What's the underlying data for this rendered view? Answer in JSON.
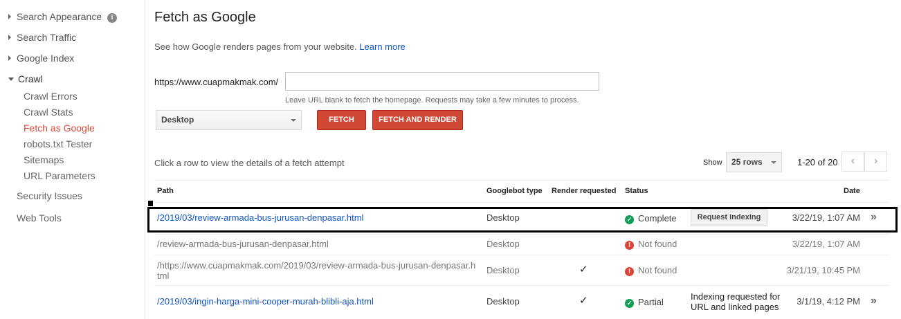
{
  "sidebar": {
    "items": [
      {
        "label": "Search Appearance"
      },
      {
        "label": "Search Traffic"
      },
      {
        "label": "Google Index"
      },
      {
        "label": "Crawl"
      }
    ],
    "crawl_sub": [
      {
        "label": "Crawl Errors"
      },
      {
        "label": "Crawl Stats"
      },
      {
        "label": "Fetch as Google"
      },
      {
        "label": "robots.txt Tester"
      },
      {
        "label": "Sitemaps"
      },
      {
        "label": "URL Parameters"
      }
    ],
    "bottom": [
      {
        "label": "Security Issues"
      },
      {
        "label": "Web Tools"
      }
    ],
    "info_glyph": "i"
  },
  "main": {
    "title": "Fetch as Google",
    "description": "See how Google renders pages from your website.",
    "learn_more": "Learn more",
    "url_prefix": "https://www.cuapmakmak.com/",
    "url_value": "",
    "hint": "Leave URL blank to fetch the homepage. Requests may take a few minutes to process.",
    "device_select": "Desktop",
    "fetch_label": "FETCH",
    "fetch_render_label": "FETCH AND RENDER",
    "click_hint": "Click a row to view the details of a fetch attempt",
    "show_label": "Show",
    "rows_select": "25 rows",
    "range": "1-20 of 20",
    "prev_glyph": "‹",
    "next_glyph": "›"
  },
  "table": {
    "headers": {
      "path": "Path",
      "googlebot": "Googlebot type",
      "render": "Render requested",
      "status": "Status",
      "date": "Date"
    },
    "rows": [
      {
        "path": "/2019/03/review-armada-bus-jurusan-denpasar.html",
        "googlebot": "Desktop",
        "render": "",
        "status": "Complete",
        "status_icon": "check-circle-icon",
        "action": "Request indexing",
        "date": "3/22/19, 1:07 AM"
      },
      {
        "path": "/review-armada-bus-jurusan-denpasar.html",
        "googlebot": "Desktop",
        "render": "",
        "status": "Not found",
        "status_icon": "error-circle-icon",
        "action": "",
        "date": "3/22/19, 1:07 AM"
      },
      {
        "path_line1": "/https://www.cuapmakmak.com/2019/03/review-armada-bus-jurusan-denpasar.h",
        "path_line2": "tml",
        "googlebot": "Desktop",
        "render": "✓",
        "status": "Not found",
        "status_icon": "error-circle-icon",
        "action": "",
        "date": "3/21/19, 10:45 PM"
      },
      {
        "path": "/2019/03/ingin-harga-mini-cooper-murah-blibli-aja.html",
        "googlebot": "Desktop",
        "render": "✓",
        "status": "Partial",
        "status_icon": "check-circle-icon",
        "action_line1": "Indexing requested for",
        "action_line2": "URL and linked pages",
        "date": "3/1/19, 4:12 PM"
      }
    ],
    "check_glyph": "✓",
    "error_glyph": "!",
    "chevron_glyph": "»"
  },
  "colors": {
    "accent_red": "#d14836",
    "link_blue": "#1155cc",
    "active_nav": "#dd4b39",
    "ok_green": "#0f9d58",
    "error_red": "#db4437"
  }
}
